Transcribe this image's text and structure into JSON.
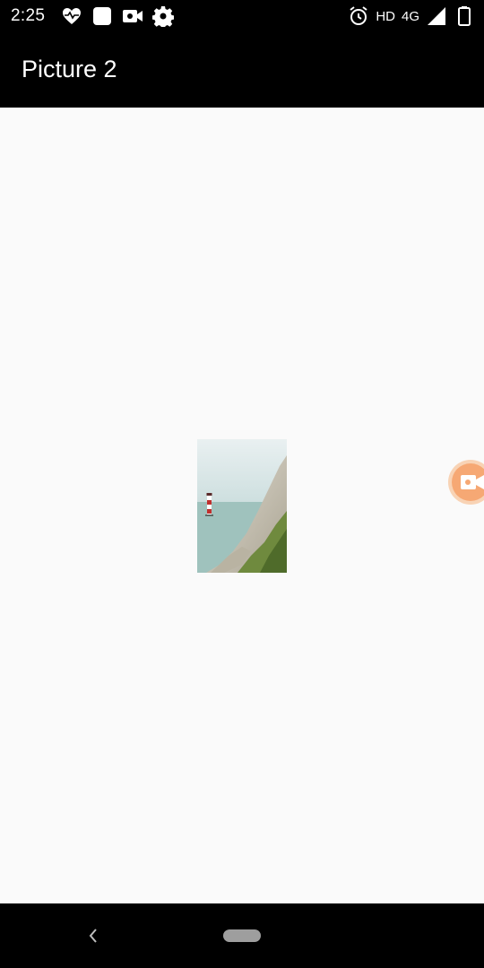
{
  "status_bar": {
    "time": "2:25",
    "hd_label": "HD",
    "network_label": "4G",
    "icons": [
      "heart-monitor-icon",
      "app-square-icon",
      "video-camera-icon",
      "settings-gear-icon",
      "alarm-clock-icon",
      "signal-icon",
      "battery-icon"
    ]
  },
  "app_bar": {
    "title": "Picture 2"
  },
  "content": {
    "picture": "lighthouse-cliff-photo",
    "floating_button_icon": "video-camera-icon"
  },
  "nav_bar": {
    "icons": [
      "back-icon",
      "home-pill-icon"
    ]
  },
  "colors": {
    "status_bar": "#000000",
    "app_bar": "#000000",
    "background": "#fafafa",
    "floating_button": "#f6a874"
  }
}
